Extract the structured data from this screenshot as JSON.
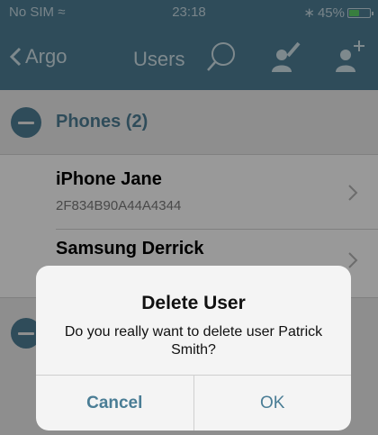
{
  "status_bar": {
    "carrier": "No SIM",
    "time": "23:18",
    "battery_percent": "45%",
    "battery_level": 0.45
  },
  "nav": {
    "back_label": "Argo",
    "title": "Users",
    "icons": [
      "search-icon",
      "edit-user-icon",
      "add-user-icon"
    ]
  },
  "section": {
    "title": "Phones (2)"
  },
  "rows": [
    {
      "name": "iPhone Jane",
      "id": "2F834B90A44A4344"
    },
    {
      "name": "Samsung Derrick"
    }
  ],
  "alert": {
    "title": "Delete User",
    "message": "Do you really want to delete user Patrick Smith?",
    "cancel_label": "Cancel",
    "ok_label": "OK"
  },
  "colors": {
    "nav_background": "#4f7f96",
    "accent": "#4a7d95"
  }
}
